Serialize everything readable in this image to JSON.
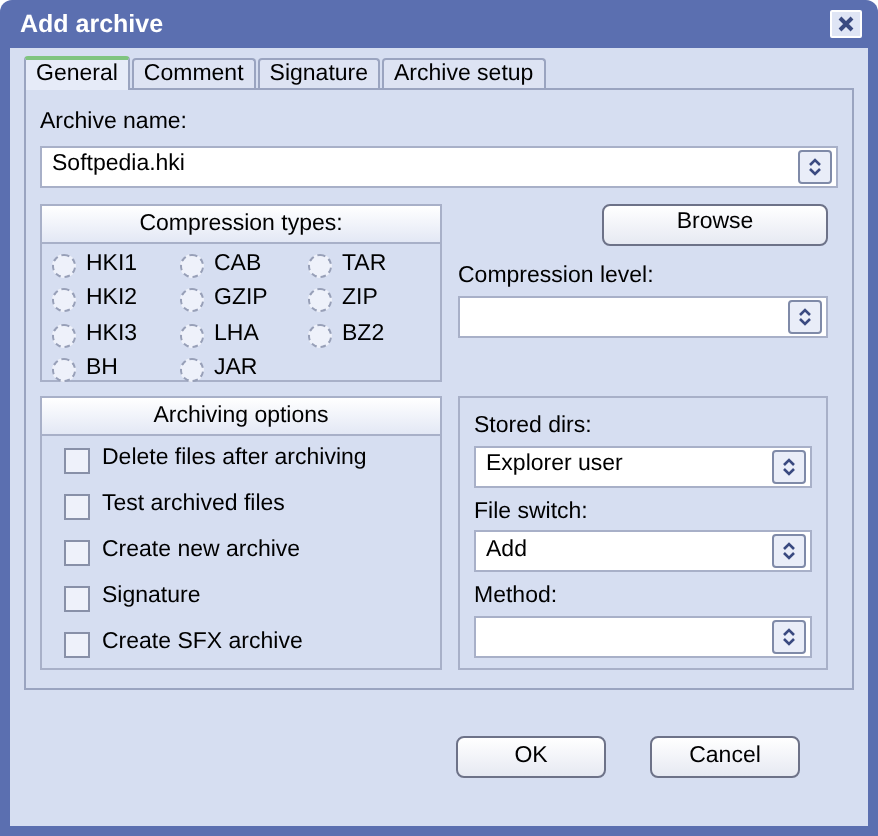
{
  "window": {
    "title": "Add archive"
  },
  "tabs": [
    {
      "label": "General",
      "selected": true
    },
    {
      "label": "Comment",
      "selected": false
    },
    {
      "label": "Signature",
      "selected": false
    },
    {
      "label": "Archive setup",
      "selected": false
    }
  ],
  "archive_name": {
    "label": "Archive name:",
    "value": "Softpedia.hki"
  },
  "compression_types": {
    "title": "Compression types:",
    "options": [
      {
        "label": "HKI1",
        "selected": false
      },
      {
        "label": "HKI2",
        "selected": false
      },
      {
        "label": "HKI3",
        "selected": false
      },
      {
        "label": "BH",
        "selected": false
      },
      {
        "label": "CAB",
        "selected": false
      },
      {
        "label": "GZIP",
        "selected": false
      },
      {
        "label": "LHA",
        "selected": false
      },
      {
        "label": "JAR",
        "selected": false
      },
      {
        "label": "TAR",
        "selected": false
      },
      {
        "label": "ZIP",
        "selected": false
      },
      {
        "label": "BZ2",
        "selected": false
      }
    ]
  },
  "browse_button": "Browse",
  "compression_level": {
    "label": "Compression level:"
  },
  "archiving_options": {
    "title": "Archiving options",
    "options": [
      {
        "label": "Delete files after archiving",
        "checked": false
      },
      {
        "label": "Test archived files",
        "checked": false
      },
      {
        "label": "Create new archive",
        "checked": false
      },
      {
        "label": "Signature",
        "checked": false
      },
      {
        "label": "Create SFX archive",
        "checked": false
      }
    ]
  },
  "stored_dirs": {
    "label": "Stored dirs:",
    "value": "Explorer user"
  },
  "file_switch": {
    "label": "File switch:",
    "value": "Add"
  },
  "method": {
    "label": "Method:"
  },
  "buttons": [
    "OK",
    "Cancel"
  ]
}
